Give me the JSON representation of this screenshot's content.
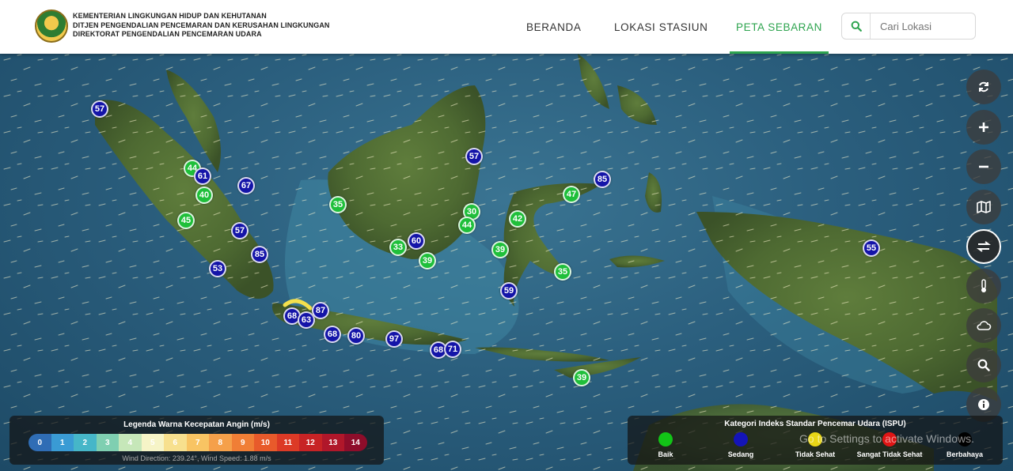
{
  "header": {
    "org_lines": [
      "KEMENTERIAN LINGKUNGAN HIDUP DAN KEHUTANAN",
      "DITJEN PENGENDALIAN PENCEMARAN DAN KERUSAHAN LINGKUNGAN",
      "DIREKTORAT PENGENDALIAN PENCEMARAN UDARA"
    ],
    "nav": [
      {
        "label": "BERANDA",
        "active": false
      },
      {
        "label": "LOKASI STASIUN",
        "active": false
      },
      {
        "label": "PETA SEBARAN",
        "active": true
      }
    ],
    "search_placeholder": "Cari Lokasi"
  },
  "markers": [
    {
      "v": "57",
      "c": "mod"
    },
    {
      "v": "44",
      "c": "good"
    },
    {
      "v": "61",
      "c": "mod"
    },
    {
      "v": "40",
      "c": "good"
    },
    {
      "v": "67",
      "c": "mod"
    },
    {
      "v": "45",
      "c": "good"
    },
    {
      "v": "57",
      "c": "mod"
    },
    {
      "v": "85",
      "c": "mod"
    },
    {
      "v": "53",
      "c": "mod"
    },
    {
      "v": "35",
      "c": "good"
    },
    {
      "v": "57",
      "c": "mod"
    },
    {
      "v": "85",
      "c": "mod"
    },
    {
      "v": "47",
      "c": "good"
    },
    {
      "v": "30",
      "c": "good"
    },
    {
      "v": "44",
      "c": "good"
    },
    {
      "v": "42",
      "c": "good"
    },
    {
      "v": "60",
      "c": "mod"
    },
    {
      "v": "33",
      "c": "good"
    },
    {
      "v": "39",
      "c": "good"
    },
    {
      "v": "39",
      "c": "good"
    },
    {
      "v": "35",
      "c": "good"
    },
    {
      "v": "59",
      "c": "mod"
    },
    {
      "v": "55",
      "c": "mod"
    },
    {
      "v": "68",
      "c": "mod"
    },
    {
      "v": "63",
      "c": "mod"
    },
    {
      "v": "87",
      "c": "mod"
    },
    {
      "v": "68",
      "c": "mod"
    },
    {
      "v": "80",
      "c": "mod"
    },
    {
      "v": "97",
      "c": "mod"
    },
    {
      "v": "68",
      "c": "mod"
    },
    {
      "v": "71",
      "c": "mod"
    },
    {
      "v": "39",
      "c": "good"
    }
  ],
  "controls": [
    {
      "name": "refresh",
      "icon": "refresh-icon"
    },
    {
      "name": "zoom-in",
      "icon": "plus-icon"
    },
    {
      "name": "zoom-out",
      "icon": "minus-icon"
    },
    {
      "name": "map-layer",
      "icon": "map-icon"
    },
    {
      "name": "wind",
      "icon": "swap-arrows-icon"
    },
    {
      "name": "temperature",
      "icon": "thermometer-icon"
    },
    {
      "name": "weather",
      "icon": "cloud-icon"
    },
    {
      "name": "search",
      "icon": "search-icon"
    },
    {
      "name": "info",
      "icon": "info-icon"
    }
  ],
  "wind_legend": {
    "title": "Legenda Warna Kecepatan Angin (m/s)",
    "scale": [
      {
        "label": "0",
        "color": "#2f6db5"
      },
      {
        "label": "1",
        "color": "#3a9bd4"
      },
      {
        "label": "2",
        "color": "#46b6c8"
      },
      {
        "label": "3",
        "color": "#7fcfb1"
      },
      {
        "label": "4",
        "color": "#c6e7b9"
      },
      {
        "label": "5",
        "color": "#f6f4c7"
      },
      {
        "label": "6",
        "color": "#f7e08e"
      },
      {
        "label": "7",
        "color": "#f8c463"
      },
      {
        "label": "8",
        "color": "#f5a04a"
      },
      {
        "label": "9",
        "color": "#f07e36"
      },
      {
        "label": "10",
        "color": "#e85a2b"
      },
      {
        "label": "11",
        "color": "#dc3a26"
      },
      {
        "label": "12",
        "color": "#c72325"
      },
      {
        "label": "13",
        "color": "#b0172a"
      },
      {
        "label": "14",
        "color": "#8e0d2a"
      }
    ],
    "reading": "Wind Direction: 239.24°, Wind Speed: 1.88 m/s"
  },
  "ispu_legend": {
    "title": "Kategori Indeks Standar Pencemar Udara (ISPU)",
    "categories": [
      {
        "label": "Baik",
        "color": "#12c417"
      },
      {
        "label": "Sedang",
        "color": "#1414b8"
      },
      {
        "label": "Tidak Sehat",
        "color": "#e8d616"
      },
      {
        "label": "Sangat Tidak Sehat",
        "color": "#e01515"
      },
      {
        "label": "Berbahaya",
        "color": "#000000"
      }
    ]
  },
  "watermark": "Go to Settings to activate Windows."
}
